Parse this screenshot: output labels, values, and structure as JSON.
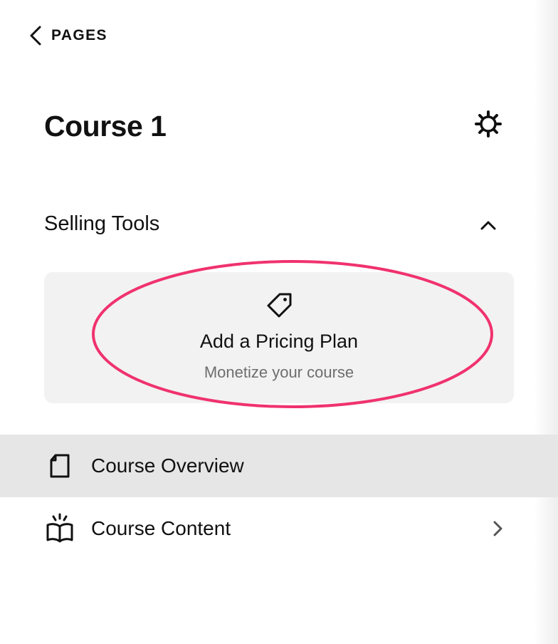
{
  "header": {
    "back_label": "PAGES",
    "back_icon": "chevron-left-icon"
  },
  "page": {
    "title": "Course 1",
    "settings_icon": "gear-icon"
  },
  "selling_tools": {
    "title": "Selling Tools",
    "collapse_icon": "chevron-up-icon",
    "card": {
      "icon": "price-tag-icon",
      "title": "Add a Pricing Plan",
      "subtitle": "Monetize your course",
      "highlight_color": "#f0326e"
    }
  },
  "nav": {
    "items": [
      {
        "label": "Course Overview",
        "icon": "page-icon",
        "selected": true
      },
      {
        "label": "Course Content",
        "icon": "open-book-icon",
        "selected": false,
        "has_submenu": true
      }
    ]
  },
  "colors": {
    "selected_row": "#e6e6e6",
    "card_background": "#f2f2f2",
    "muted_text": "#6e6e6e"
  }
}
